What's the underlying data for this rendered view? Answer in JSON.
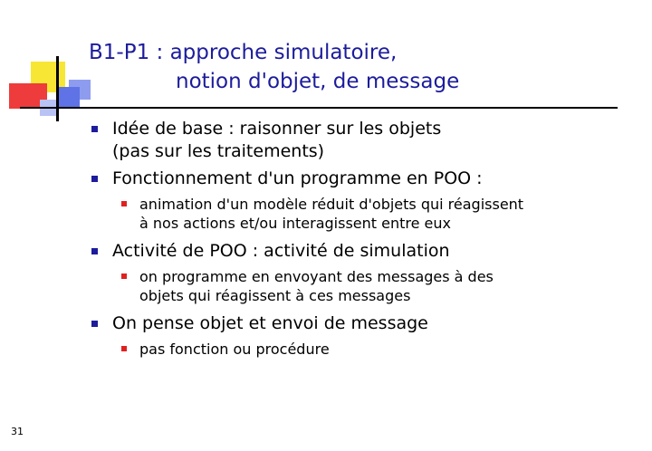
{
  "title": {
    "line1": "B1-P1 : approche simulatoire,",
    "line2": "notion d'objet, de message"
  },
  "bullets": [
    {
      "lines": [
        "Idée de base : raisonner sur les objets",
        "(pas sur les traitements)"
      ]
    },
    {
      "lines": [
        "Fonctionnement d'un programme en POO :"
      ],
      "sub": [
        {
          "lines": [
            "animation d'un modèle réduit d'objets qui réagissent",
            "à nos actions et/ou interagissent entre eux"
          ]
        }
      ]
    },
    {
      "lines": [
        "Activité de POO : activité de simulation"
      ],
      "sub": [
        {
          "lines": [
            "on programme en envoyant des messages à des",
            "objets qui réagissent à ces messages"
          ]
        }
      ]
    },
    {
      "lines": [
        "On pense objet et envoi de message"
      ],
      "sub": [
        {
          "lines": [
            "pas fonction ou procédure"
          ]
        }
      ]
    }
  ],
  "page_number": "31",
  "colors": {
    "title": "#1c1c9c",
    "bullet_level1": "#1c1c9c",
    "bullet_level2": "#e02020",
    "logo_yellow": "#f7e633",
    "logo_red": "#ee3b3b",
    "logo_blue": "#5f73e6"
  }
}
